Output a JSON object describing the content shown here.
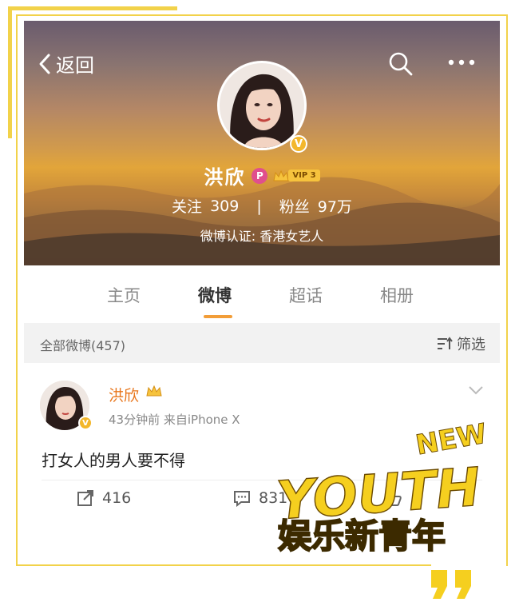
{
  "header": {
    "back_label": "返回",
    "name": "洪欣",
    "badge_p": "P",
    "badge_v": "V",
    "vip_label": "VIP 3",
    "following_label": "关注",
    "following_count": "309",
    "separator": "|",
    "followers_label": "粉丝",
    "followers_count": "97万",
    "verification": "微博认证: 香港女艺人"
  },
  "tabs": [
    {
      "label": "主页"
    },
    {
      "label": "微博"
    },
    {
      "label": "超话"
    },
    {
      "label": "相册"
    }
  ],
  "active_tab": "微博",
  "filter": {
    "all_posts": "全部微博(457)",
    "filter_label": "筛选"
  },
  "post": {
    "author": "洪欣",
    "badge_v": "V",
    "meta": "43分钟前  来自iPhone X",
    "text": "打女人的男人要不得",
    "reposts": "416",
    "comments": "831"
  },
  "overlay": {
    "new": "NEW",
    "youth": "YOUTH",
    "chinese": "娱乐新青年"
  },
  "colors": {
    "frame": "#f2d24a",
    "tab_underline": "#f29d38",
    "author": "#e8751a",
    "overlay_text": "#f5cf1f"
  },
  "icons": [
    "back-chevron-icon",
    "search-icon",
    "more-icon",
    "vip-crown-icon",
    "filter-icon",
    "chevron-down-icon",
    "repost-icon",
    "comment-icon",
    "like-icon",
    "quote-icon"
  ]
}
